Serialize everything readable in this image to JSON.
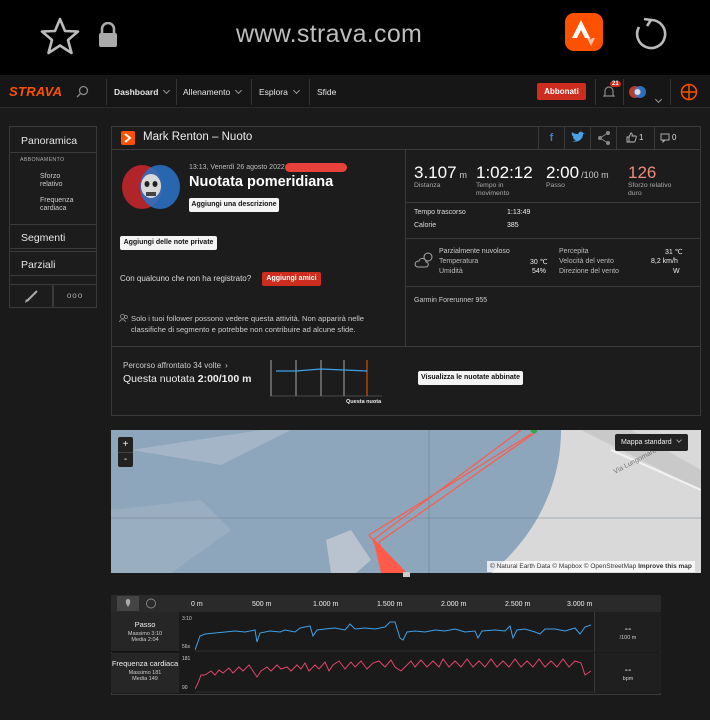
{
  "browser": {
    "url": "www.strava.com"
  },
  "nav": {
    "brand": "STRAVA",
    "dashboard": "Dashboard",
    "training": "Allenamento",
    "explore": "Esplora",
    "challenges": "Sfide",
    "subscribe": "Abbonati",
    "notifications": "21"
  },
  "sidebar": {
    "overview": "Panoramica",
    "subscription": "ABBONAMENTO",
    "relative_effort": "Sforzo relativo",
    "heart_rate": "Frequenza cardiaca",
    "segments": "Segmenti",
    "splits": "Parziali",
    "more": "ooo"
  },
  "header": {
    "title": "Mark Renton – Nuoto",
    "kudos": "1",
    "comments": "0"
  },
  "activity": {
    "datetime": "13:13, Venerdì 26 agosto 2022",
    "name": "Nuotata pomeridiana",
    "add_description": "Aggiungi una descrizione",
    "add_private_notes": "Aggiungi delle note private",
    "with_someone": "Con qualcuno che non ha registrato?",
    "add_friends": "Aggiungi amici",
    "privacy_note": "Solo i tuoi follower possono vedere questa attività. Non apparirà nelle classifiche di segmento e potrebbe non contribuire ad alcune sfide."
  },
  "stats": {
    "distance": {
      "value": "3.107",
      "unit": "m",
      "label": "Distanza"
    },
    "moving_time": {
      "value": "1:02:12",
      "label": "Tempo in movimento"
    },
    "pace": {
      "value": "2:00",
      "unit": "/100 m",
      "label": "Passo"
    },
    "relative_effort": {
      "value": "126",
      "label": "Sforzo relativo duro"
    },
    "elapsed_label": "Tempo trascorso",
    "elapsed_value": "1:13:49",
    "calories_label": "Calorie",
    "calories_value": "385"
  },
  "weather": {
    "condition": "Parzialmente nuvoloso",
    "temperature_label": "Temperatura",
    "temperature": "30 ℃",
    "humidity_label": "Umidità",
    "humidity": "54%",
    "feels_label": "Percepita",
    "feels": "31 ℃",
    "wind_speed_label": "Velocità del vento",
    "wind_speed": "8,2 km/h",
    "wind_dir_label": "Direzione del vento",
    "wind_dir": "W"
  },
  "device": "Garmin Forerunner 955",
  "route": {
    "times": "Percorso affrontato 34 volte",
    "this_swim": "Questa nuotata",
    "this_pace": "2:00/100",
    "this_pace_unit": "m",
    "marker_label": "Questa nuota",
    "view_matched": "Visualizza le nuotate abbinate"
  },
  "map": {
    "style": "Mappa standard",
    "zoom_in": "+",
    "zoom_out": "-",
    "attribution": "© Natural Earth Data © Mapbox © OpenStreetMap",
    "improve": "Improve this map",
    "street": "Via Lungomare di P"
  },
  "analysis": {
    "ticks": [
      "0 m",
      "500 m",
      "1.000 m",
      "1.500 m",
      "2.000 m",
      "2.500 m",
      "3.000 m"
    ],
    "pace": {
      "label": "Passo",
      "max": "Massimo 3:10",
      "avg": "Media 2:04",
      "top": "3:10",
      "bottom": "56s",
      "readout": "--",
      "unit": "/100 m"
    },
    "hr": {
      "label": "Frequenza cardiaca",
      "max": "Massimo 181",
      "avg": "Media 149",
      "top": "181",
      "bottom": "90",
      "readout": "--",
      "unit": "bpm"
    }
  },
  "colors": {
    "brand": "#fc5200",
    "button_red": "#cc2d1f",
    "pace_line": "#3fa0e8",
    "hr_line": "#e0456a",
    "route": "#ff5a4a",
    "water": "#8fa7bd"
  }
}
